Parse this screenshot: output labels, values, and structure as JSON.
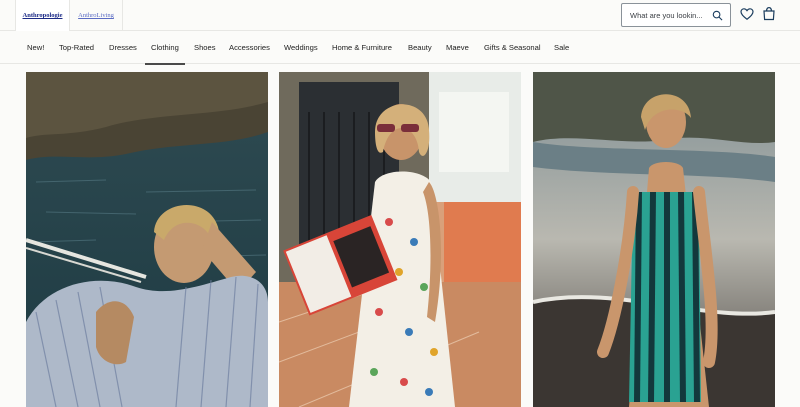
{
  "header": {
    "brand_tabs": [
      {
        "label": "Anthropologie",
        "active": true
      },
      {
        "label": "AnthroLiving",
        "active": false
      }
    ],
    "search": {
      "placeholder": "What are you lookin..."
    },
    "icons": [
      "search-icon",
      "heart-icon",
      "shopping-bag-icon"
    ]
  },
  "nav": {
    "items": [
      {
        "label": "New!"
      },
      {
        "label": "Top-Rated"
      },
      {
        "label": "Dresses"
      },
      {
        "label": "Clothing",
        "selected": true
      },
      {
        "label": "Shoes"
      },
      {
        "label": "Accessories"
      },
      {
        "label": "Weddings"
      },
      {
        "label": "Home & Furniture"
      },
      {
        "label": "Beauty"
      },
      {
        "label": "Maeve"
      },
      {
        "label": "Gifts & Seasonal"
      },
      {
        "label": "Sale"
      }
    ]
  },
  "hero": {
    "images": [
      {
        "subject": "model in blue striped shirt on boat by the sea"
      },
      {
        "subject": "model in white printed sundress with sunglasses holding a magazine"
      },
      {
        "subject": "model in teal striped dress on the beach"
      }
    ]
  },
  "colors": {
    "brand_link": "#1b2a86",
    "nav_underline": "#4a4a4a",
    "background": "#fbfbf9"
  }
}
